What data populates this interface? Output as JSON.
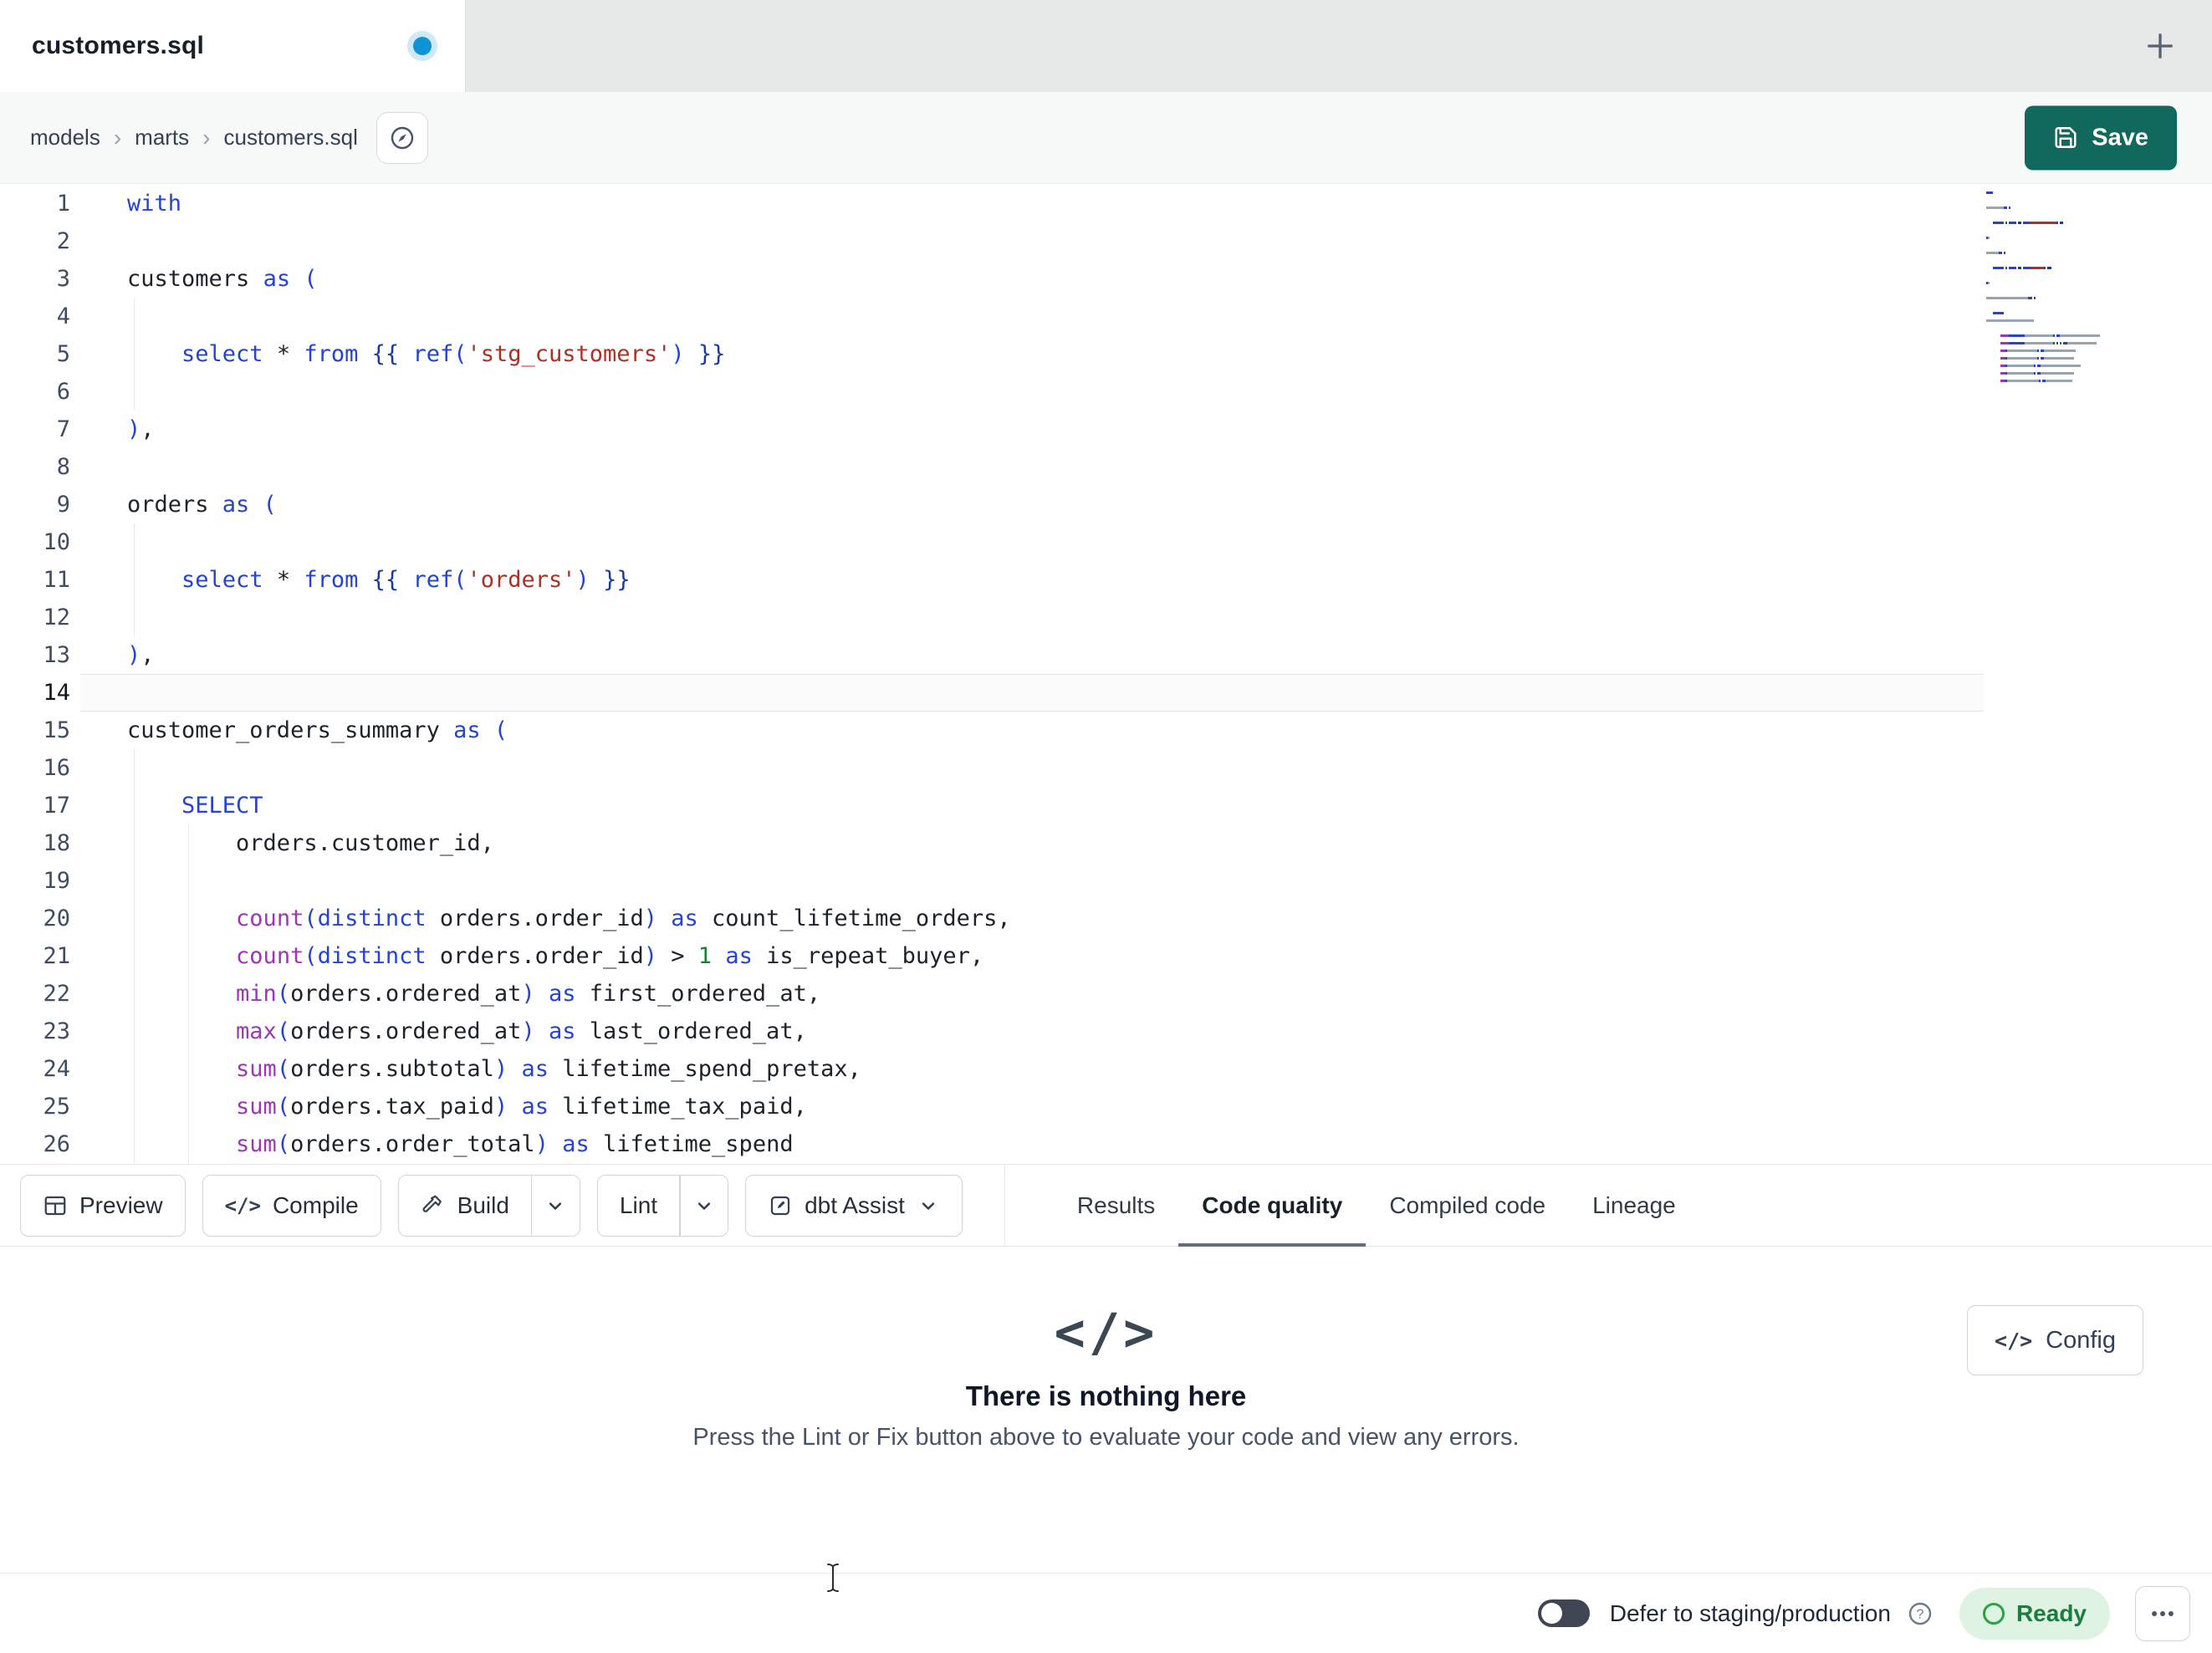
{
  "window": {
    "tab_title": "customers.sql",
    "new_tab": "+"
  },
  "breadcrumb": {
    "items": [
      "models",
      "marts",
      "customers.sql"
    ],
    "separator": "›"
  },
  "actions": {
    "save": "Save"
  },
  "icons": {
    "code_glyph": "</>"
  },
  "colors": {
    "save_button": "#11695e",
    "unsaved_dot": "#0d93d6",
    "ready_green": "#1c7c3f",
    "keyword_blue": "#2444d0",
    "string_red": "#a93226",
    "function_purple": "#9c36b5"
  },
  "editor": {
    "active_line": 14,
    "lines": [
      {
        "n": 1,
        "tokens": [
          [
            "kw",
            "with"
          ]
        ]
      },
      {
        "n": 2,
        "tokens": []
      },
      {
        "n": 3,
        "tokens": [
          [
            "pl",
            "customers "
          ],
          [
            "kw",
            "as"
          ],
          [
            "pl",
            " "
          ],
          [
            "br",
            "("
          ]
        ]
      },
      {
        "n": 4,
        "g": 1,
        "tokens": []
      },
      {
        "n": 5,
        "g": 1,
        "tokens": [
          [
            "pl",
            "    "
          ],
          [
            "kw",
            "select"
          ],
          [
            "pl",
            " "
          ],
          [
            "op",
            "*"
          ],
          [
            "pl",
            " "
          ],
          [
            "kw",
            "from"
          ],
          [
            "pl",
            " "
          ],
          [
            "jn",
            "{{"
          ],
          [
            "pl",
            " "
          ],
          [
            "kw",
            "ref"
          ],
          [
            "br",
            "("
          ],
          [
            "str",
            "'stg_customers'"
          ],
          [
            "br",
            ")"
          ],
          [
            "pl",
            " "
          ],
          [
            "jn",
            "}}"
          ]
        ]
      },
      {
        "n": 6,
        "g": 1,
        "tokens": []
      },
      {
        "n": 7,
        "tokens": [
          [
            "br",
            ")"
          ],
          [
            "pl",
            ","
          ]
        ]
      },
      {
        "n": 8,
        "tokens": []
      },
      {
        "n": 9,
        "tokens": [
          [
            "pl",
            "orders "
          ],
          [
            "kw",
            "as"
          ],
          [
            "pl",
            " "
          ],
          [
            "br",
            "("
          ]
        ]
      },
      {
        "n": 10,
        "g": 1,
        "tokens": []
      },
      {
        "n": 11,
        "g": 1,
        "tokens": [
          [
            "pl",
            "    "
          ],
          [
            "kw",
            "select"
          ],
          [
            "pl",
            " "
          ],
          [
            "op",
            "*"
          ],
          [
            "pl",
            " "
          ],
          [
            "kw",
            "from"
          ],
          [
            "pl",
            " "
          ],
          [
            "jn",
            "{{"
          ],
          [
            "pl",
            " "
          ],
          [
            "kw",
            "ref"
          ],
          [
            "br",
            "("
          ],
          [
            "str",
            "'orders'"
          ],
          [
            "br",
            ")"
          ],
          [
            "pl",
            " "
          ],
          [
            "jn",
            "}}"
          ]
        ]
      },
      {
        "n": 12,
        "g": 1,
        "tokens": []
      },
      {
        "n": 13,
        "tokens": [
          [
            "br",
            ")"
          ],
          [
            "pl",
            ","
          ]
        ]
      },
      {
        "n": 14,
        "tokens": []
      },
      {
        "n": 15,
        "tokens": [
          [
            "pl",
            "customer_orders_summary "
          ],
          [
            "kw",
            "as"
          ],
          [
            "pl",
            " "
          ],
          [
            "br",
            "("
          ]
        ]
      },
      {
        "n": 16,
        "g": 1,
        "tokens": []
      },
      {
        "n": 17,
        "g": 1,
        "tokens": [
          [
            "pl",
            "    "
          ],
          [
            "kw",
            "SELECT"
          ]
        ]
      },
      {
        "n": 18,
        "g": 2,
        "tokens": [
          [
            "pl",
            "        orders.customer_id,"
          ]
        ]
      },
      {
        "n": 19,
        "g": 2,
        "tokens": []
      },
      {
        "n": 20,
        "g": 2,
        "tokens": [
          [
            "pl",
            "        "
          ],
          [
            "fn",
            "count"
          ],
          [
            "br",
            "("
          ],
          [
            "kw",
            "distinct"
          ],
          [
            "pl",
            " orders.order_id"
          ],
          [
            "br",
            ")"
          ],
          [
            "pl",
            " "
          ],
          [
            "kw",
            "as"
          ],
          [
            "pl",
            " count_lifetime_orders,"
          ]
        ]
      },
      {
        "n": 21,
        "g": 2,
        "tokens": [
          [
            "pl",
            "        "
          ],
          [
            "fn",
            "count"
          ],
          [
            "br",
            "("
          ],
          [
            "kw",
            "distinct"
          ],
          [
            "pl",
            " orders.order_id"
          ],
          [
            "br",
            ")"
          ],
          [
            "pl",
            " "
          ],
          [
            "op",
            ">"
          ],
          [
            "pl",
            " "
          ],
          [
            "num",
            "1"
          ],
          [
            "pl",
            " "
          ],
          [
            "kw",
            "as"
          ],
          [
            "pl",
            " is_repeat_buyer,"
          ]
        ]
      },
      {
        "n": 22,
        "g": 2,
        "tokens": [
          [
            "pl",
            "        "
          ],
          [
            "fn",
            "min"
          ],
          [
            "br",
            "("
          ],
          [
            "pl",
            "orders.ordered_at"
          ],
          [
            "br",
            ")"
          ],
          [
            "pl",
            " "
          ],
          [
            "kw",
            "as"
          ],
          [
            "pl",
            " first_ordered_at,"
          ]
        ]
      },
      {
        "n": 23,
        "g": 2,
        "tokens": [
          [
            "pl",
            "        "
          ],
          [
            "fn",
            "max"
          ],
          [
            "br",
            "("
          ],
          [
            "pl",
            "orders.ordered_at"
          ],
          [
            "br",
            ")"
          ],
          [
            "pl",
            " "
          ],
          [
            "kw",
            "as"
          ],
          [
            "pl",
            " last_ordered_at,"
          ]
        ]
      },
      {
        "n": 24,
        "g": 2,
        "tokens": [
          [
            "pl",
            "        "
          ],
          [
            "fn",
            "sum"
          ],
          [
            "br",
            "("
          ],
          [
            "pl",
            "orders.subtotal"
          ],
          [
            "br",
            ")"
          ],
          [
            "pl",
            " "
          ],
          [
            "kw",
            "as"
          ],
          [
            "pl",
            " lifetime_spend_pretax,"
          ]
        ]
      },
      {
        "n": 25,
        "g": 2,
        "tokens": [
          [
            "pl",
            "        "
          ],
          [
            "fn",
            "sum"
          ],
          [
            "br",
            "("
          ],
          [
            "pl",
            "orders.tax_paid"
          ],
          [
            "br",
            ")"
          ],
          [
            "pl",
            " "
          ],
          [
            "kw",
            "as"
          ],
          [
            "pl",
            " lifetime_tax_paid,"
          ]
        ]
      },
      {
        "n": 26,
        "g": 2,
        "tokens": [
          [
            "pl",
            "        "
          ],
          [
            "fn",
            "sum"
          ],
          [
            "br",
            "("
          ],
          [
            "pl",
            "orders.order_total"
          ],
          [
            "br",
            ")"
          ],
          [
            "pl",
            " "
          ],
          [
            "kw",
            "as"
          ],
          [
            "pl",
            " lifetime_spend"
          ]
        ]
      }
    ]
  },
  "toolbar": {
    "preview": "Preview",
    "compile": "Compile",
    "build": "Build",
    "lint": "Lint",
    "dbt_assist": "dbt Assist"
  },
  "result_tabs": [
    {
      "label": "Results",
      "active": false
    },
    {
      "label": "Code quality",
      "active": true
    },
    {
      "label": "Compiled code",
      "active": false
    },
    {
      "label": "Lineage",
      "active": false
    }
  ],
  "results_panel": {
    "empty_title": "There is nothing here",
    "empty_subtitle": "Press the Lint or Fix button above to evaluate your code and view any errors.",
    "config": "Config"
  },
  "statusbar": {
    "defer_label": "Defer to staging/production",
    "ready": "Ready"
  }
}
